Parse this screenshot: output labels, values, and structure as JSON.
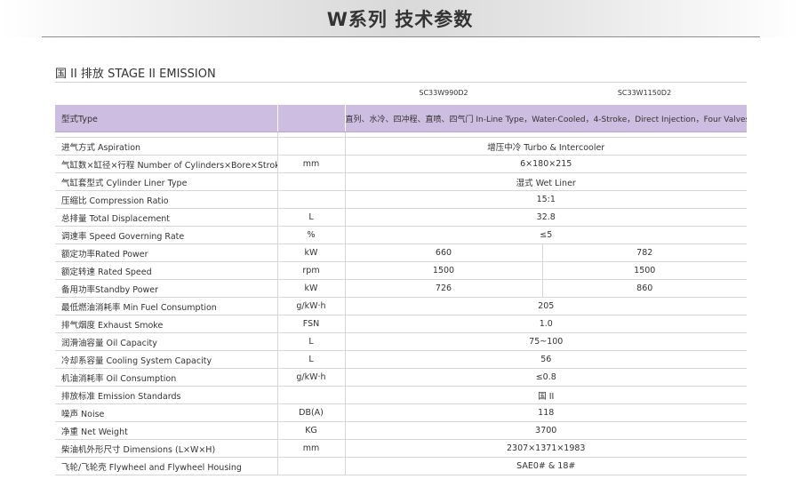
{
  "header": {
    "title": "W系列 技术参数"
  },
  "section": {
    "title": "国 II 排放 STAGE II EMISSION"
  },
  "models": [
    "SC33W990D2",
    "SC33W1150D2"
  ],
  "type_row": {
    "name": "型式Type",
    "unit": "",
    "value": "直列、水冷、四冲程、直喷、四气门 In-Line Type，Water-Cooled，4-Stroke，Direct Injection，Four Valves"
  },
  "rows": [
    {
      "name": "进气方式 Aspiration",
      "unit": "",
      "values": [
        "增压中冷 Turbo & Intercooler"
      ]
    },
    {
      "name": "气缸数×缸径×行程 Number of Cylinders×Bore×Stroke",
      "unit": "mm",
      "values": [
        "6×180×215"
      ]
    },
    {
      "name": "气缸套型式 Cylinder Liner Type",
      "unit": "",
      "values": [
        "湿式 Wet Liner"
      ]
    },
    {
      "name": "压缩比 Compression Ratio",
      "unit": "",
      "values": [
        "15:1"
      ]
    },
    {
      "name": "总排量 Total Displacement",
      "unit": "L",
      "values": [
        "32.8"
      ]
    },
    {
      "name": "调速率 Speed Governing Rate",
      "unit": "%",
      "values": [
        "≤5"
      ]
    },
    {
      "name": "额定功率Rated Power",
      "unit": "kW",
      "values": [
        "660",
        "782"
      ]
    },
    {
      "name": "额定转速 Rated Speed",
      "unit": "rpm",
      "values": [
        "1500",
        "1500"
      ]
    },
    {
      "name": "备用功率Standby Power",
      "unit": "kW",
      "values": [
        "726",
        "860"
      ]
    },
    {
      "name": "最低燃油消耗率 Min Fuel Consumption",
      "unit": "g/kW·h",
      "values": [
        "205"
      ]
    },
    {
      "name": "排气烟度 Exhaust Smoke",
      "unit": "FSN",
      "values": [
        "1.0"
      ]
    },
    {
      "name": "润滑油容量 Oil Capacity",
      "unit": "L",
      "values": [
        "75~100"
      ]
    },
    {
      "name": "冷却系容量 Cooling System Capacity",
      "unit": "L",
      "values": [
        "56"
      ]
    },
    {
      "name": "机油消耗率 Oil Consumption",
      "unit": "g/kW·h",
      "values": [
        "≤0.8"
      ]
    },
    {
      "name": "排放标准 Emission Standards",
      "unit": "",
      "values": [
        "国 II"
      ]
    },
    {
      "name": "噪声 Noise",
      "unit": "DB(A)",
      "values": [
        "118"
      ]
    },
    {
      "name": "净重 Net Weight",
      "unit": "KG",
      "values": [
        "3700"
      ]
    },
    {
      "name": "柴油机外形尺寸 Dimensions (L×W×H)",
      "unit": "mm",
      "values": [
        "2307×1371×1983"
      ]
    },
    {
      "name": "飞轮/飞轮壳 Flywheel and Flywheel Housing",
      "unit": "",
      "values": [
        "SAE0# & 18#"
      ]
    }
  ]
}
